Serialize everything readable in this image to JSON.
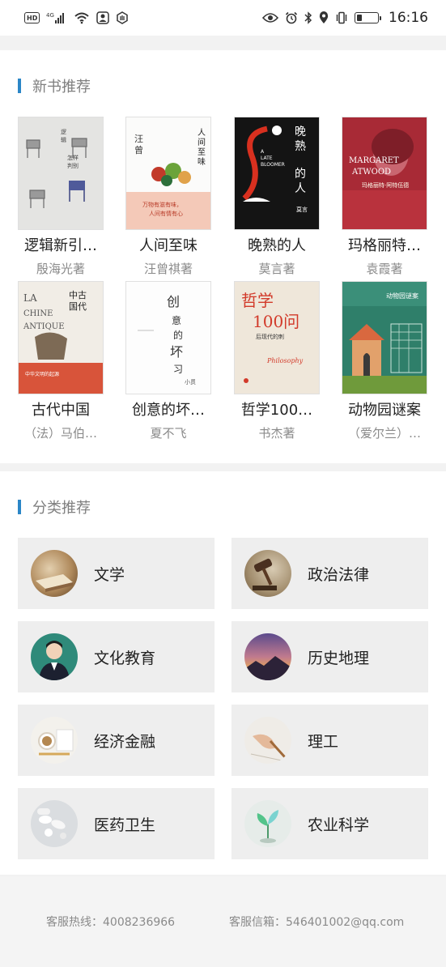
{
  "status_bar": {
    "hd": "HD",
    "network": "4G",
    "time": "16:16",
    "battery_level": 0.25
  },
  "new_books": {
    "title": "新书推荐",
    "books": [
      {
        "title": "逻辑新引…",
        "author": "殷海光著",
        "cover_text": "逻辑新引 怎样判别是非"
      },
      {
        "title": "人间至味",
        "author": "汪曾祺著",
        "cover_text": "人间至味",
        "cover_sub": "万物有滋有味，人间有情有心",
        "cover_sign": "汪曾祺"
      },
      {
        "title": "晚熟的人",
        "author": "莫言著",
        "cover_text": "晚熟的人",
        "cover_en": "A LATE BLOOMER",
        "cover_sign": "莫言"
      },
      {
        "title": "玛格丽特…",
        "author": "袁霞著",
        "cover_text": "MARGARET ATWOOD",
        "cover_sub": "玛格丽特·阿特伍德"
      },
      {
        "title": "古代中国",
        "author": "（法）马伯…",
        "cover_text": "中古国代",
        "cover_fr": "LA CHINE ANTIQUE"
      },
      {
        "title": "创意的坏…",
        "author": "夏不飞",
        "cover_text": "创意的坏习惯"
      },
      {
        "title": "哲学100…",
        "author": "书杰著",
        "cover_text": "哲学100问",
        "cover_sub": "后现代的刺",
        "cover_en": "Philosophy"
      },
      {
        "title": "动物园谜案",
        "author": "（爱尔兰）…",
        "cover_text": "动物园谜案"
      }
    ]
  },
  "categories": {
    "title": "分类推荐",
    "items": [
      {
        "label": "文学",
        "icon": "literature-photo"
      },
      {
        "label": "政治法律",
        "icon": "gavel-photo"
      },
      {
        "label": "文化教育",
        "icon": "student-photo"
      },
      {
        "label": "历史地理",
        "icon": "landscape-photo"
      },
      {
        "label": "经济金融",
        "icon": "coffee-desk-photo"
      },
      {
        "label": "理工",
        "icon": "writing-hand-photo"
      },
      {
        "label": "医药卫生",
        "icon": "pills-photo"
      },
      {
        "label": "农业科学",
        "icon": "plant-photo"
      }
    ]
  },
  "footer": {
    "hotline": "客服热线：4008236966",
    "email": "客服信箱：546401002@qq.com"
  },
  "colors": {
    "accent": "#2b86c7",
    "tile_bg": "#eeeeee",
    "muted_text": "#8a8a8a"
  }
}
